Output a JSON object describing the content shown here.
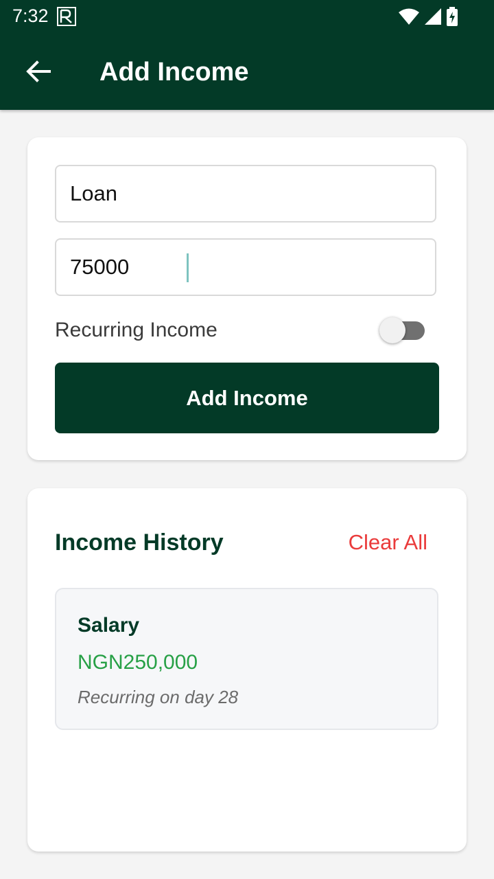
{
  "status_bar": {
    "time": "7:32",
    "icons": [
      "app-notification-icon",
      "wifi-icon",
      "signal-icon",
      "battery-charging-icon"
    ]
  },
  "header": {
    "title": "Add Income",
    "back_icon": "arrow-left-icon"
  },
  "form": {
    "name_value": "Loan",
    "amount_value": "75000",
    "recurring_label": "Recurring Income",
    "recurring_enabled": false,
    "submit_label": "Add Income"
  },
  "history": {
    "title": "Income History",
    "clear_label": "Clear All",
    "items": [
      {
        "name": "Salary",
        "amount": "NGN250,000",
        "recurring": "Recurring on day 28"
      }
    ]
  },
  "colors": {
    "brand": "#033a27",
    "danger": "#ea3b3b",
    "amount_green": "#27a046",
    "background": "#f4f4f4"
  }
}
